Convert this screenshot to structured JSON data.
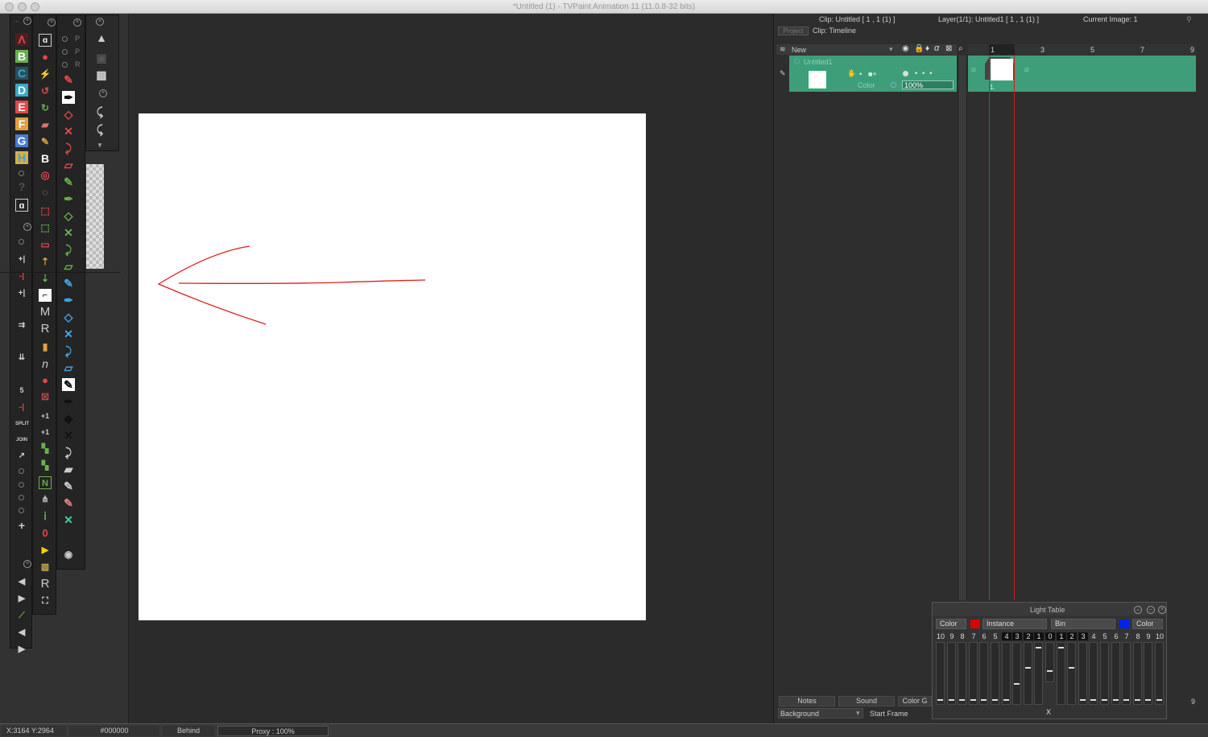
{
  "window": {
    "title": "*Untitled (1) - TVPaint Animation 11 (11.0.8-32 bits)"
  },
  "toolstrip1": {
    "dots_label": "...",
    "close_label": "x",
    "letters": [
      "Λ",
      "B",
      "C",
      "D",
      "E",
      "F",
      "G",
      "H"
    ],
    "question": "?"
  },
  "toolstrip2": {
    "labels": [
      "B",
      "M",
      "R",
      "n",
      "N",
      "R"
    ]
  },
  "toolstrip3": {
    "labels": [
      "P",
      "P",
      "R"
    ]
  },
  "timeline": {
    "clip_info": "Clip: Untitled [ 1 , 1  (1) ]",
    "layer_info": "Layer(1/1): Untitled1 [ 1 , 1  (1) ]",
    "current_image": "Current Image: 1",
    "project_tab": "Project",
    "clip_tab": "Clip: Timeline",
    "new_label": "New",
    "layer_name": "Untitled1",
    "layer_color_label": "Color",
    "opacity": "100%",
    "frame_numbers": [
      "1",
      "3",
      "5",
      "7",
      "9"
    ],
    "cel_label": "1."
  },
  "bottom_tabs": {
    "notes": "Notes",
    "sound": "Sound",
    "color_groups": "Color G",
    "background": "Background",
    "start_frame": "Start Frame",
    "right_num": "9"
  },
  "light_table": {
    "title": "Light Table",
    "color_left": "Color",
    "instance": "Instance",
    "bin": "Bin",
    "color_right": "Color",
    "left_numbers": [
      "10",
      "9",
      "8",
      "7",
      "6",
      "5",
      "4",
      "3",
      "2",
      "1"
    ],
    "center": "0",
    "right_numbers": [
      "1",
      "2",
      "3",
      "4",
      "5",
      "6",
      "7",
      "8",
      "9",
      "10"
    ],
    "x_label": "X",
    "left_color": "#dd0000",
    "right_color": "#0022ee"
  },
  "statusbar": {
    "coords": "X:3164  Y:2964",
    "color": "#000000",
    "mode": "Behind",
    "proxy": "Proxy : 100%"
  },
  "colors": {
    "layer_green": "#3e9e7a",
    "stroke_red": "#e02020"
  }
}
